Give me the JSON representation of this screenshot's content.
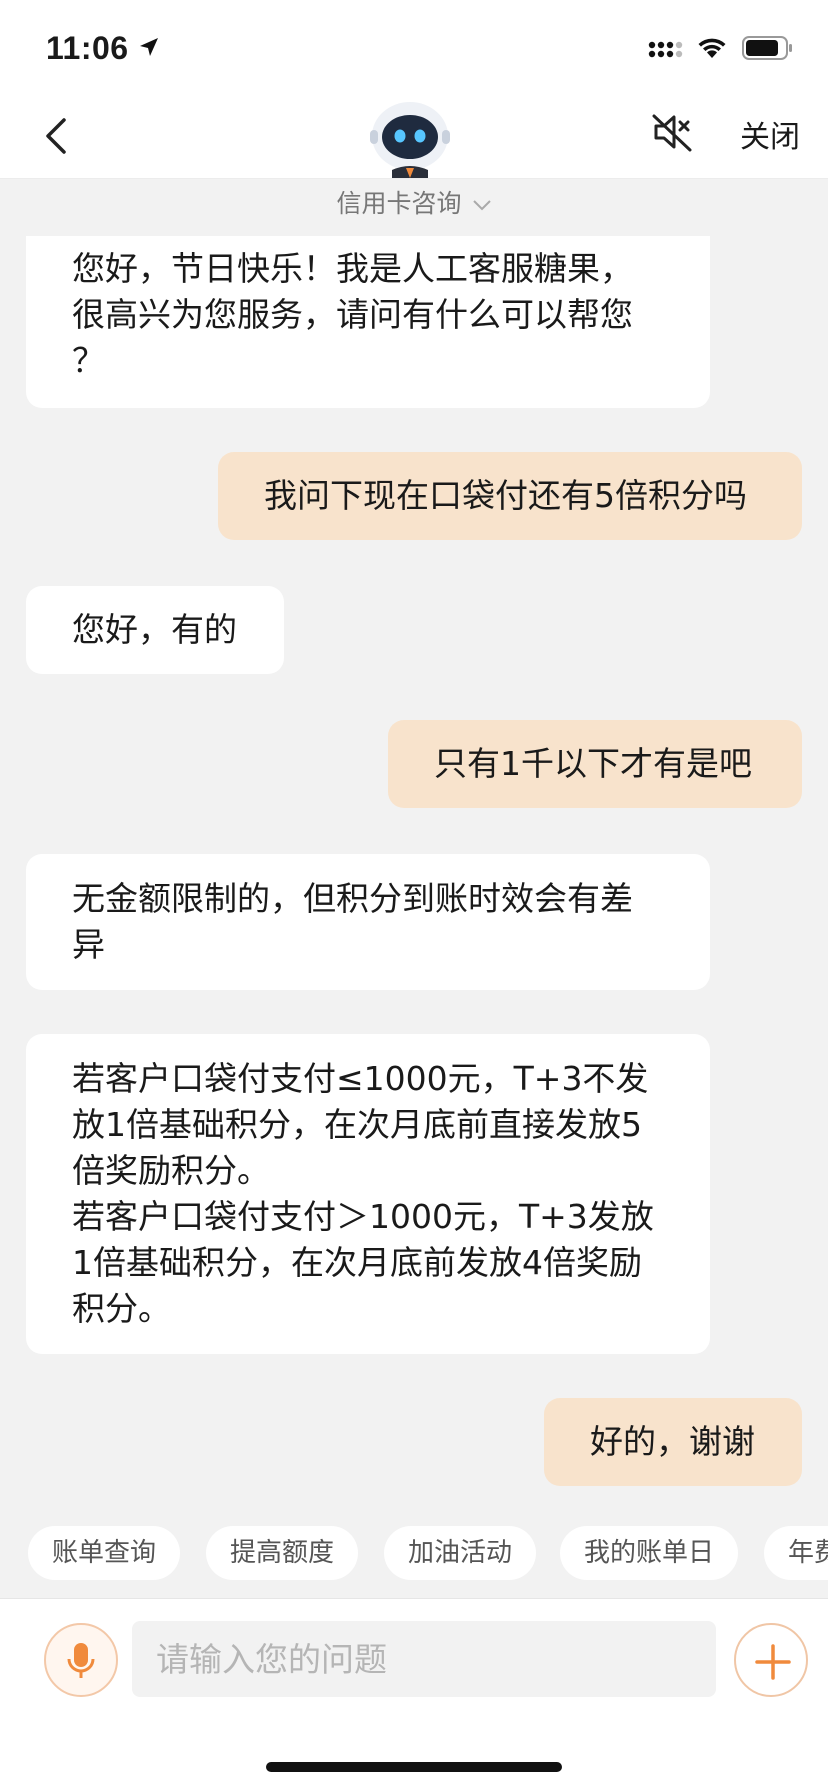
{
  "status_bar": {
    "time": "11:06"
  },
  "nav": {
    "close_label": "关闭",
    "topic": "信用卡咨询"
  },
  "messages": [
    {
      "from": "bot",
      "text": "您好，节日快乐！我是人工客服糖果，\n很高兴为您服务，请问有什么可以帮您\n？"
    },
    {
      "from": "user",
      "text": "我问下现在口袋付还有5倍积分吗"
    },
    {
      "from": "bot",
      "text": "您好，有的"
    },
    {
      "from": "user",
      "text": "只有1千以下才有是吧"
    },
    {
      "from": "bot",
      "text": "无金额限制的，但积分到账时效会有差\n异"
    },
    {
      "from": "bot",
      "text": "若客户口袋付支付≤1000元，T+3不发\n放1倍基础积分，在次月底前直接发放5\n倍奖励积分。\n若客户口袋付支付＞1000元，T+3发放\n1倍基础积分，在次月底前发放4倍奖励\n积分。"
    },
    {
      "from": "user",
      "text": "好的，谢谢"
    }
  ],
  "quick_chips": [
    "账单查询",
    "提高额度",
    "加油活动",
    "我的账单日",
    "年费"
  ],
  "input": {
    "placeholder": "请输入您的问题",
    "value": ""
  },
  "colors": {
    "user_bubble": "#f8e3cc",
    "accent": "#f08a3c",
    "background": "#f2f2f2"
  }
}
